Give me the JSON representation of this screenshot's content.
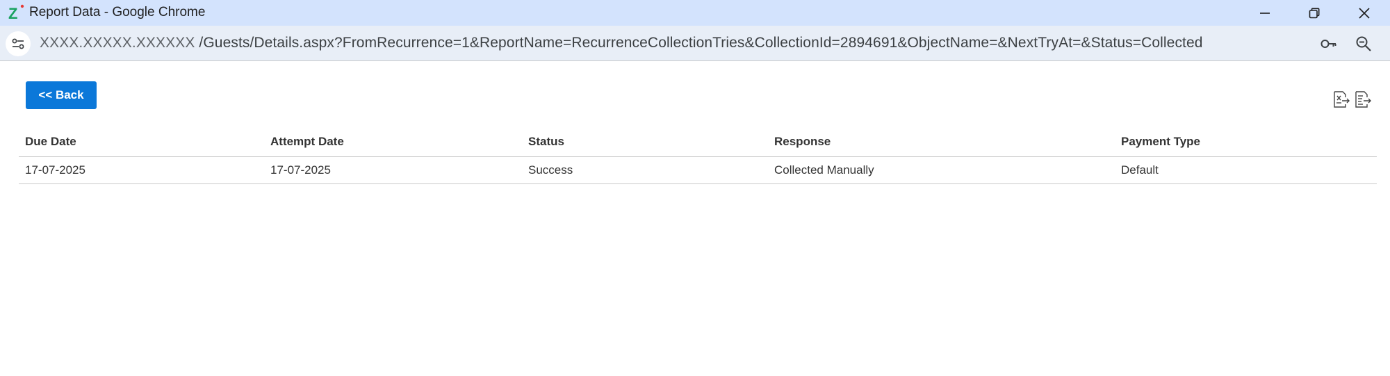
{
  "window": {
    "title": "Report Data - Google Chrome",
    "logo_letter": "Z"
  },
  "address_bar": {
    "host": "XXXX.XXXXX.XXXXXX",
    "path": " /Guests/Details.aspx?FromRecurrence=1&ReportName=RecurrenceCollectionTries&CollectionId=2894691&ObjectName=&NextTryAt=&Status=Collected"
  },
  "page": {
    "back_label": "<< Back",
    "export_icons": [
      "excel-export-icon",
      "csv-export-icon"
    ]
  },
  "table": {
    "headers": [
      "Due Date",
      "Attempt Date",
      "Status",
      "Response",
      "Payment Type"
    ],
    "rows": [
      [
        "17-07-2025",
        "17-07-2025",
        "Success",
        "Collected Manually",
        "Default"
      ]
    ]
  },
  "colors": {
    "titlebar_bg": "#d3e3fd",
    "addressbar_bg": "#e8eef7",
    "back_button_bg": "#0b78d9",
    "logo_green": "#1aa260"
  }
}
